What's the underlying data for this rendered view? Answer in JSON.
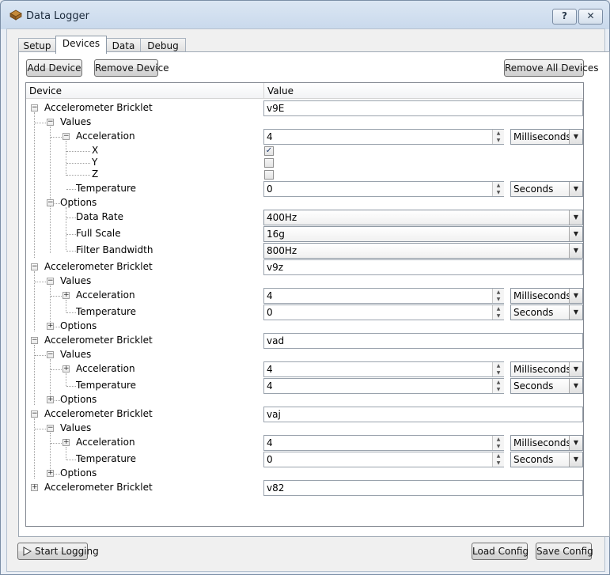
{
  "window": {
    "title": "Data Logger",
    "help_label": "?",
    "close_label": "✕"
  },
  "tabs": [
    "Setup",
    "Devices",
    "Data",
    "Debug"
  ],
  "toolbar": {
    "add_device": "Add Device",
    "remove_device": "Remove Device",
    "remove_all": "Remove All Devices"
  },
  "tree": {
    "headers": {
      "device": "Device",
      "value": "Value"
    },
    "devices": [
      {
        "name": "Accelerometer Bricklet",
        "uid": "v9E",
        "values_label": "Values",
        "options_label": "Options",
        "acceleration": {
          "label": "Acceleration",
          "value": "4",
          "unit": "Milliseconds",
          "axes": [
            {
              "label": "X",
              "checked": true
            },
            {
              "label": "Y",
              "checked": false
            },
            {
              "label": "Z",
              "checked": false
            }
          ]
        },
        "temperature": {
          "label": "Temperature",
          "value": "0",
          "unit": "Seconds"
        },
        "options": [
          {
            "label": "Data Rate",
            "value": "400Hz"
          },
          {
            "label": "Full Scale",
            "value": "16g"
          },
          {
            "label": "Filter Bandwidth",
            "value": "800Hz"
          }
        ]
      },
      {
        "name": "Accelerometer Bricklet",
        "uid": "v9z",
        "values_label": "Values",
        "options_label": "Options",
        "acceleration": {
          "label": "Acceleration",
          "value": "4",
          "unit": "Milliseconds"
        },
        "temperature": {
          "label": "Temperature",
          "value": "0",
          "unit": "Seconds"
        }
      },
      {
        "name": "Accelerometer Bricklet",
        "uid": "vad",
        "values_label": "Values",
        "options_label": "Options",
        "acceleration": {
          "label": "Acceleration",
          "value": "4",
          "unit": "Milliseconds"
        },
        "temperature": {
          "label": "Temperature",
          "value": "4",
          "unit": "Seconds"
        }
      },
      {
        "name": "Accelerometer Bricklet",
        "uid": "vaj",
        "values_label": "Values",
        "options_label": "Options",
        "acceleration": {
          "label": "Acceleration",
          "value": "4",
          "unit": "Milliseconds"
        },
        "temperature": {
          "label": "Temperature",
          "value": "0",
          "unit": "Seconds"
        }
      },
      {
        "name": "Accelerometer Bricklet",
        "uid": "v82"
      }
    ]
  },
  "footer": {
    "start_logging": "Start Logging",
    "load_config": "Load Config",
    "save_config": "Save Config"
  }
}
